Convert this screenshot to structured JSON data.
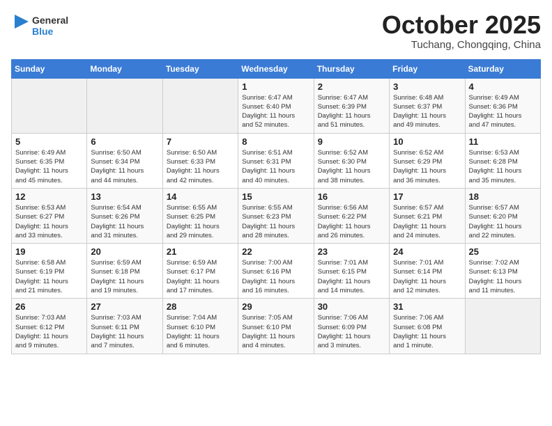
{
  "header": {
    "logo_general": "General",
    "logo_blue": "Blue",
    "month_title": "October 2025",
    "location": "Tuchang, Chongqing, China"
  },
  "weekdays": [
    "Sunday",
    "Monday",
    "Tuesday",
    "Wednesday",
    "Thursday",
    "Friday",
    "Saturday"
  ],
  "weeks": [
    [
      {
        "day": "",
        "info": ""
      },
      {
        "day": "",
        "info": ""
      },
      {
        "day": "",
        "info": ""
      },
      {
        "day": "1",
        "info": "Sunrise: 6:47 AM\nSunset: 6:40 PM\nDaylight: 11 hours\nand 52 minutes."
      },
      {
        "day": "2",
        "info": "Sunrise: 6:47 AM\nSunset: 6:39 PM\nDaylight: 11 hours\nand 51 minutes."
      },
      {
        "day": "3",
        "info": "Sunrise: 6:48 AM\nSunset: 6:37 PM\nDaylight: 11 hours\nand 49 minutes."
      },
      {
        "day": "4",
        "info": "Sunrise: 6:49 AM\nSunset: 6:36 PM\nDaylight: 11 hours\nand 47 minutes."
      }
    ],
    [
      {
        "day": "5",
        "info": "Sunrise: 6:49 AM\nSunset: 6:35 PM\nDaylight: 11 hours\nand 45 minutes."
      },
      {
        "day": "6",
        "info": "Sunrise: 6:50 AM\nSunset: 6:34 PM\nDaylight: 11 hours\nand 44 minutes."
      },
      {
        "day": "7",
        "info": "Sunrise: 6:50 AM\nSunset: 6:33 PM\nDaylight: 11 hours\nand 42 minutes."
      },
      {
        "day": "8",
        "info": "Sunrise: 6:51 AM\nSunset: 6:31 PM\nDaylight: 11 hours\nand 40 minutes."
      },
      {
        "day": "9",
        "info": "Sunrise: 6:52 AM\nSunset: 6:30 PM\nDaylight: 11 hours\nand 38 minutes."
      },
      {
        "day": "10",
        "info": "Sunrise: 6:52 AM\nSunset: 6:29 PM\nDaylight: 11 hours\nand 36 minutes."
      },
      {
        "day": "11",
        "info": "Sunrise: 6:53 AM\nSunset: 6:28 PM\nDaylight: 11 hours\nand 35 minutes."
      }
    ],
    [
      {
        "day": "12",
        "info": "Sunrise: 6:53 AM\nSunset: 6:27 PM\nDaylight: 11 hours\nand 33 minutes."
      },
      {
        "day": "13",
        "info": "Sunrise: 6:54 AM\nSunset: 6:26 PM\nDaylight: 11 hours\nand 31 minutes."
      },
      {
        "day": "14",
        "info": "Sunrise: 6:55 AM\nSunset: 6:25 PM\nDaylight: 11 hours\nand 29 minutes."
      },
      {
        "day": "15",
        "info": "Sunrise: 6:55 AM\nSunset: 6:23 PM\nDaylight: 11 hours\nand 28 minutes."
      },
      {
        "day": "16",
        "info": "Sunrise: 6:56 AM\nSunset: 6:22 PM\nDaylight: 11 hours\nand 26 minutes."
      },
      {
        "day": "17",
        "info": "Sunrise: 6:57 AM\nSunset: 6:21 PM\nDaylight: 11 hours\nand 24 minutes."
      },
      {
        "day": "18",
        "info": "Sunrise: 6:57 AM\nSunset: 6:20 PM\nDaylight: 11 hours\nand 22 minutes."
      }
    ],
    [
      {
        "day": "19",
        "info": "Sunrise: 6:58 AM\nSunset: 6:19 PM\nDaylight: 11 hours\nand 21 minutes."
      },
      {
        "day": "20",
        "info": "Sunrise: 6:59 AM\nSunset: 6:18 PM\nDaylight: 11 hours\nand 19 minutes."
      },
      {
        "day": "21",
        "info": "Sunrise: 6:59 AM\nSunset: 6:17 PM\nDaylight: 11 hours\nand 17 minutes."
      },
      {
        "day": "22",
        "info": "Sunrise: 7:00 AM\nSunset: 6:16 PM\nDaylight: 11 hours\nand 16 minutes."
      },
      {
        "day": "23",
        "info": "Sunrise: 7:01 AM\nSunset: 6:15 PM\nDaylight: 11 hours\nand 14 minutes."
      },
      {
        "day": "24",
        "info": "Sunrise: 7:01 AM\nSunset: 6:14 PM\nDaylight: 11 hours\nand 12 minutes."
      },
      {
        "day": "25",
        "info": "Sunrise: 7:02 AM\nSunset: 6:13 PM\nDaylight: 11 hours\nand 11 minutes."
      }
    ],
    [
      {
        "day": "26",
        "info": "Sunrise: 7:03 AM\nSunset: 6:12 PM\nDaylight: 11 hours\nand 9 minutes."
      },
      {
        "day": "27",
        "info": "Sunrise: 7:03 AM\nSunset: 6:11 PM\nDaylight: 11 hours\nand 7 minutes."
      },
      {
        "day": "28",
        "info": "Sunrise: 7:04 AM\nSunset: 6:10 PM\nDaylight: 11 hours\nand 6 minutes."
      },
      {
        "day": "29",
        "info": "Sunrise: 7:05 AM\nSunset: 6:10 PM\nDaylight: 11 hours\nand 4 minutes."
      },
      {
        "day": "30",
        "info": "Sunrise: 7:06 AM\nSunset: 6:09 PM\nDaylight: 11 hours\nand 3 minutes."
      },
      {
        "day": "31",
        "info": "Sunrise: 7:06 AM\nSunset: 6:08 PM\nDaylight: 11 hours\nand 1 minute."
      },
      {
        "day": "",
        "info": ""
      }
    ]
  ]
}
